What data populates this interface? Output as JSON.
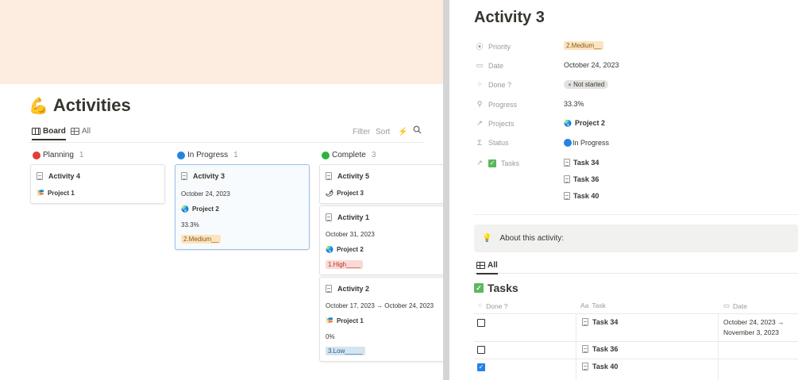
{
  "board": {
    "title": "Activities",
    "title_icon": "arm-emoji-icon",
    "views": [
      {
        "label": "Board",
        "icon": "board-icon",
        "active": true
      },
      {
        "label": "All",
        "icon": "table-icon",
        "active": false
      }
    ],
    "toolbar": {
      "filter": "Filter",
      "sort": "Sort",
      "automation_icon": "lightning-icon",
      "search_icon": "search-icon"
    },
    "groups": [
      {
        "name": "Planning",
        "count": "1",
        "color": "#e03e3e"
      },
      {
        "name": "In Progress",
        "count": "1",
        "color": "#2383e2"
      },
      {
        "name": "Complete",
        "count": "3",
        "color": "#2db33e"
      }
    ],
    "cards": [
      {
        "title": "Activity 4",
        "project": "Project 1",
        "project_icon": "🎏"
      },
      {
        "title": "Activity 3",
        "date": "October 24, 2023",
        "project": "Project 2",
        "project_icon": "🌏",
        "progress": "33.3%",
        "priority": "2.Medium__"
      },
      {
        "title": "Activity 5",
        "project": "Project 3",
        "project_icon": "🌶"
      },
      {
        "title": "Activity 1",
        "date": "October 31, 2023",
        "project": "Project 2",
        "project_icon": "🌏",
        "priority": "1.High____"
      },
      {
        "title": "Activity 2",
        "date": "October 17, 2023 → October 24, 2023",
        "project": "Project 1",
        "project_icon": "🎏",
        "progress": "0%",
        "priority": "3.Low_____"
      }
    ]
  },
  "detail": {
    "title": "Activity 3",
    "properties": {
      "priority": {
        "label": "Priority",
        "value": "2.Medium__"
      },
      "date": {
        "label": "Date",
        "value": "October 24, 2023"
      },
      "done": {
        "label": "Done ?",
        "value": "Not started"
      },
      "progress": {
        "label": "Progress",
        "value": "33.3%"
      },
      "projects": {
        "label": "Projects",
        "value": "Project 2",
        "icon": "🌏"
      },
      "status": {
        "label": "Status",
        "value": "In Progress",
        "color": "#2383e2"
      },
      "tasks": {
        "label": "Tasks",
        "values": [
          "Task 34",
          "Task 36",
          "Task 40"
        ]
      }
    },
    "callout": {
      "icon": "lightbulb-icon",
      "text": "About this activity:"
    },
    "view_tab": "All",
    "tasks_title": "Tasks",
    "table": {
      "headers": {
        "done": "Done ?",
        "task_prefix": "Aa",
        "task": "Task",
        "date": "Date"
      },
      "rows": [
        {
          "done": false,
          "task": "Task 34",
          "date_line1": "October 24, 2023 →",
          "date_line2": "November 3, 2023"
        },
        {
          "done": false,
          "task": "Task 36",
          "date_line1": "",
          "date_line2": ""
        },
        {
          "done": true,
          "task": "Task 40",
          "date_line1": "",
          "date_line2": ""
        }
      ]
    }
  }
}
